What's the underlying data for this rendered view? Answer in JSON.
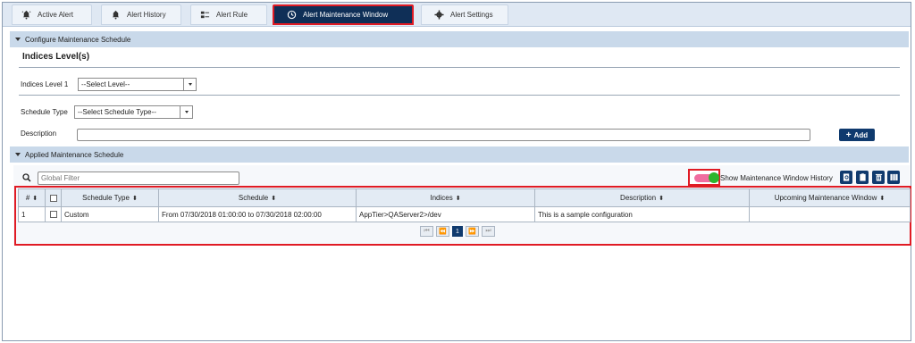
{
  "tabs": [
    {
      "label": "Active Alert",
      "icon": "active-alert-icon"
    },
    {
      "label": "Alert History",
      "icon": "bell-icon"
    },
    {
      "label": "Alert Rule",
      "icon": "rule-icon"
    },
    {
      "label": "Alert Maintenance Window",
      "icon": "clock-icon",
      "active": true
    },
    {
      "label": "Alert Settings",
      "icon": "gear-icon"
    }
  ],
  "configure": {
    "section_title": "Configure Maintenance Schedule",
    "indices_heading": "Indices Level(s)",
    "indices_level_label": "Indices Level 1",
    "indices_level_value": "--Select Level--",
    "schedule_type_label": "Schedule Type",
    "schedule_type_value": "--Select Schedule Type--",
    "description_label": "Description",
    "description_value": "",
    "add_label": "Add"
  },
  "applied": {
    "section_title": "Applied Maintenance Schedule",
    "filter_placeholder": "Global Filter",
    "toggle_label": "Show Maintenance Window History",
    "toggle_on": true,
    "columns": [
      "#",
      "",
      "Schedule Type",
      "Schedule",
      "Indices",
      "Description",
      "Upcoming Maintenance Window"
    ],
    "rows": [
      {
        "num": "1",
        "schedule_type": "Custom",
        "schedule": "From 07/30/2018 01:00:00 to 07/30/2018 02:00:00",
        "indices": "AppTier>QAServer2>/dev",
        "description": "This is a sample configuration",
        "upcoming": ""
      }
    ],
    "pager": {
      "current_page": "1"
    }
  },
  "colors": {
    "active_tab": "#0f2f57",
    "highlight": "#e01b24",
    "section_bar": "#c9d9ea",
    "toggle_track": "#f06da0",
    "toggle_knob": "#2cb52c",
    "button": "#0f3a6e"
  }
}
